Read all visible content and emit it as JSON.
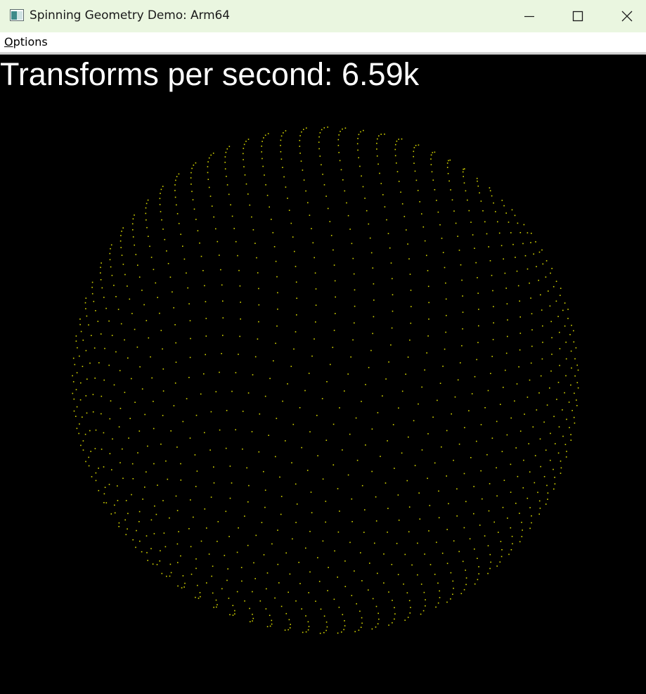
{
  "window": {
    "title": "Spinning Geometry Demo: Arm64",
    "controls": [
      "minimize",
      "maximize",
      "close"
    ]
  },
  "menu": {
    "items": [
      {
        "label": "Options",
        "accelerator": "O"
      }
    ]
  },
  "canvas": {
    "stats_label": "Transforms per second: 6.59k",
    "background": "#000000",
    "point_color": "#d4d400"
  },
  "icons": {
    "app": "app-window-icon",
    "minimize": "minimize-icon",
    "maximize": "maximize-icon",
    "close": "close-icon"
  }
}
